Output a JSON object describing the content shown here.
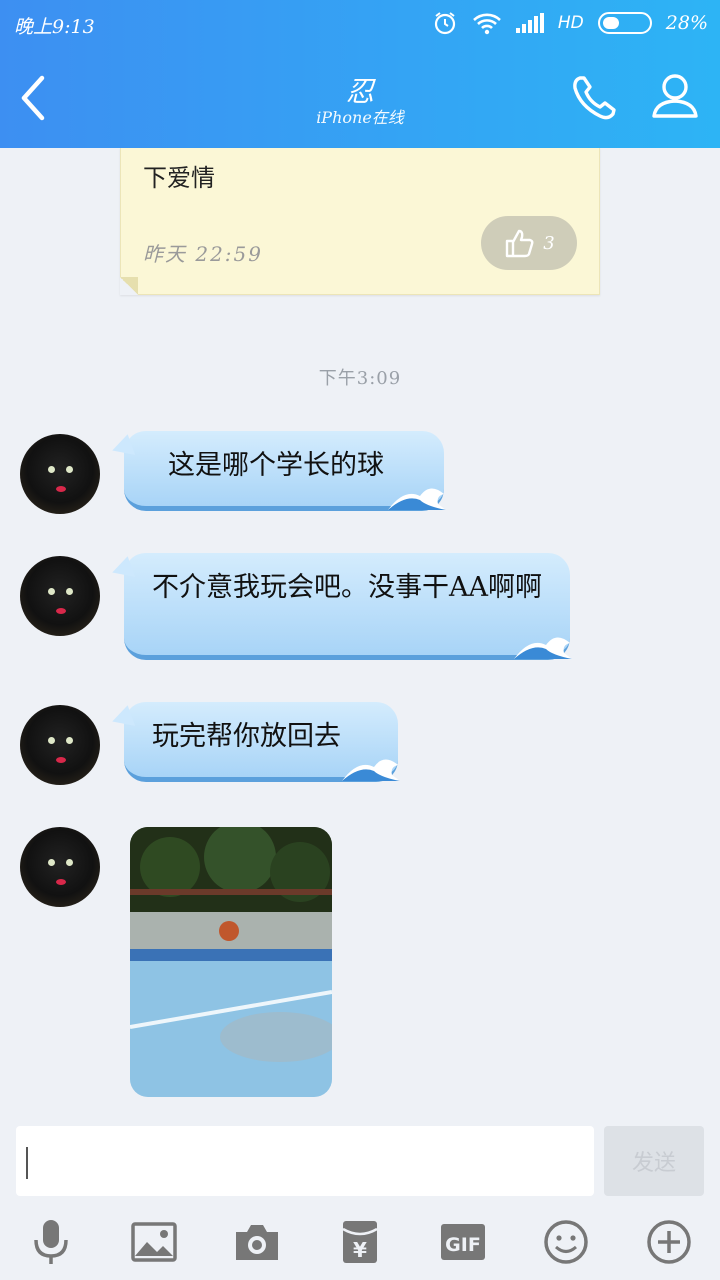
{
  "status_bar": {
    "time": "晚上9:13",
    "network": "HD",
    "battery": "28%"
  },
  "header": {
    "title": "忍",
    "subtitle": "iPhone在线"
  },
  "pinned_note": {
    "text": "下爱情",
    "time": "昨天  22:59",
    "likes": "3"
  },
  "timestamp": "下午3:09",
  "messages": [
    {
      "text": "这是哪个学长的球"
    },
    {
      "text": "不介意我玩会吧。没事干AA啊啊"
    },
    {
      "text": "玩完帮你放回去"
    }
  ],
  "input": {
    "value": "",
    "send_label": "发送"
  },
  "toolbar": [
    "mic-icon",
    "image-icon",
    "camera-icon",
    "red-packet-icon",
    "gif-icon",
    "emoji-icon",
    "plus-icon"
  ],
  "colors": {
    "header_start": "#3d8ff2",
    "header_end": "#2db4f5",
    "bubble": "#bfe0fa",
    "note": "#fbf7d6"
  }
}
